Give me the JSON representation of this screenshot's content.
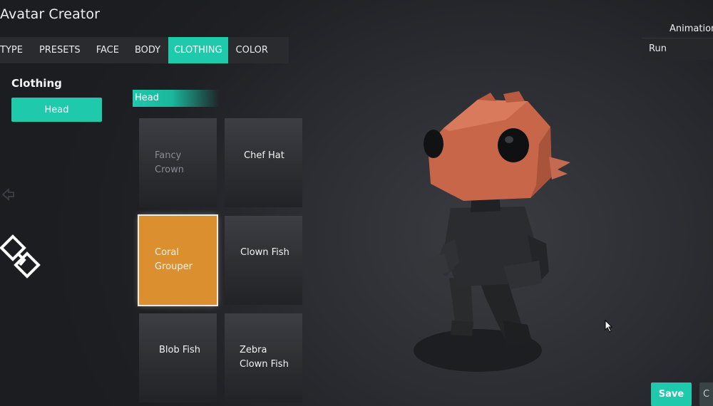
{
  "app": {
    "title": "Avatar Creator"
  },
  "tabs": [
    {
      "label": "TYPE"
    },
    {
      "label": "PRESETS"
    },
    {
      "label": "FACE"
    },
    {
      "label": "BODY"
    },
    {
      "label": "CLOTHING",
      "active": true
    },
    {
      "label": "COLOR"
    }
  ],
  "sidebar": {
    "title": "Clothing",
    "category_button": "Head"
  },
  "catalog": {
    "category": "Head",
    "items": [
      {
        "label": "Fancy Crown",
        "state": "disabled"
      },
      {
        "label": "Chef Hat",
        "state": "normal"
      },
      {
        "label": "Coral Grouper",
        "state": "selected"
      },
      {
        "label": "Clown Fish",
        "state": "normal"
      },
      {
        "label": "Blob Fish",
        "state": "normal"
      },
      {
        "label": "Zebra Clown Fish",
        "state": "normal"
      }
    ]
  },
  "animation": {
    "label": "Animation",
    "value": "Run"
  },
  "actions": {
    "save": "Save",
    "close": "C"
  },
  "colors": {
    "accent": "#1ec9ac",
    "selected": "#dc8f2e",
    "background": "#2b2d32"
  },
  "icons": [
    "diamond-arrows-icon",
    "mouse-cursor-icon"
  ]
}
